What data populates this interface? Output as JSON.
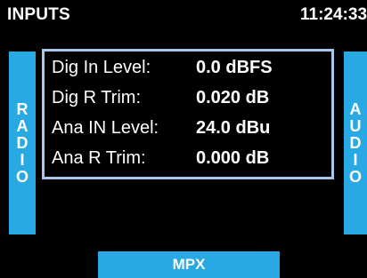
{
  "header": {
    "title": "INPUTS",
    "clock": "11:24:33"
  },
  "side_buttons": {
    "left": [
      "R",
      "A",
      "D",
      "I",
      "O"
    ],
    "right": [
      "A",
      "U",
      "D",
      "I",
      "O"
    ]
  },
  "rows": [
    {
      "label": "Dig In Level:",
      "value": "0.0 dBFS"
    },
    {
      "label": "Dig R Trim:",
      "value": "0.020 dB"
    },
    {
      "label": "Ana IN Level:",
      "value": "24.0 dBu"
    },
    {
      "label": "Ana R Trim:",
      "value": "0.000 dB"
    }
  ],
  "bottom_button": {
    "label": "MPX"
  },
  "colors": {
    "background": "#000000",
    "accent": "#29a9e3",
    "panel_border": "#a9c7e8",
    "text": "#ffffff"
  }
}
